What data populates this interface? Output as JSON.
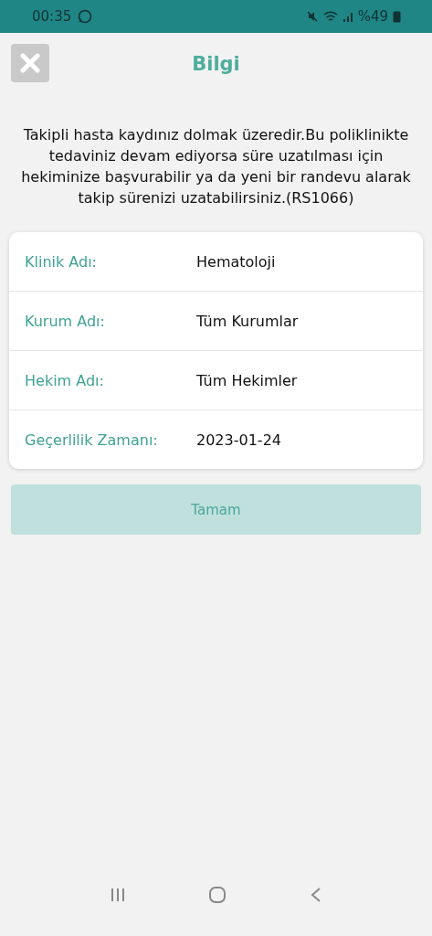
{
  "status_bar": {
    "time": "00:35",
    "battery": "%49"
  },
  "header": {
    "title": "Bilgi"
  },
  "message": "Takipli hasta kaydınız dolmak üzeredir.Bu poliklinikte tedaviniz devam ediyorsa süre uzatılması için hekiminize başvurabilir ya da yeni bir randevu alarak takip sürenizi uzatabilirsiniz.(RS1066)",
  "details": [
    {
      "label": "Klinik Adı:",
      "value": "Hematoloji"
    },
    {
      "label": "Kurum Adı:",
      "value": "Tüm Kurumlar"
    },
    {
      "label": "Hekim Adı:",
      "value": "Tüm Hekimler"
    },
    {
      "label": "Geçerlilik Zamanı:",
      "value": "2023-01-24"
    }
  ],
  "ok_button": {
    "label": "Tamam"
  }
}
